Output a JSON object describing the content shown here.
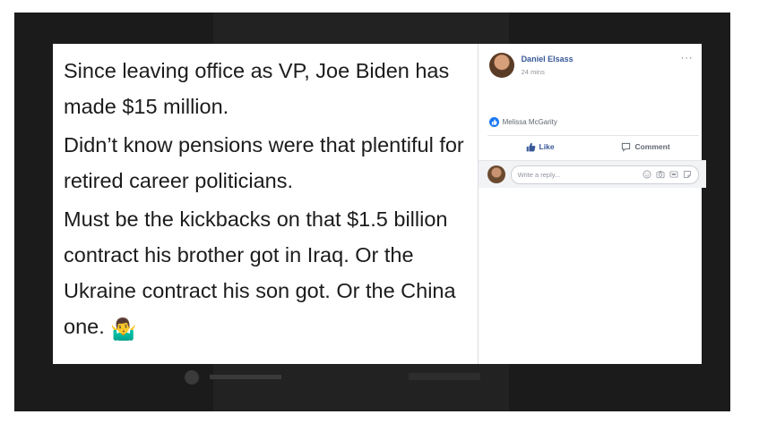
{
  "post": {
    "paragraph_1": "Since leaving office as VP, Joe Biden has made $15 million.",
    "paragraph_2": "Didn’t know pensions were that plentiful for retired career politicians.",
    "paragraph_3": "Must be the kickbacks on that $1.5 billion contract his brother got in Iraq. Or the Ukraine contract his son got. Or the China one.",
    "emoji": "🤷‍♂️"
  },
  "facebook": {
    "author": "Daniel Elsass",
    "time": "24 mins",
    "more": "···",
    "liked_by": "Melissa McGarity",
    "like_label": "Like",
    "comment_label": "Comment",
    "reply_placeholder": "Write a reply..."
  },
  "colors": {
    "link_blue": "#385898",
    "like_blue": "#1877f2",
    "backdrop": "#1b1b1b"
  },
  "icons": [
    "like-icon",
    "thumbs-up-icon",
    "comment-icon",
    "emoji-icon",
    "camera-icon",
    "gif-icon",
    "sticker-icon",
    "more-icon"
  ]
}
